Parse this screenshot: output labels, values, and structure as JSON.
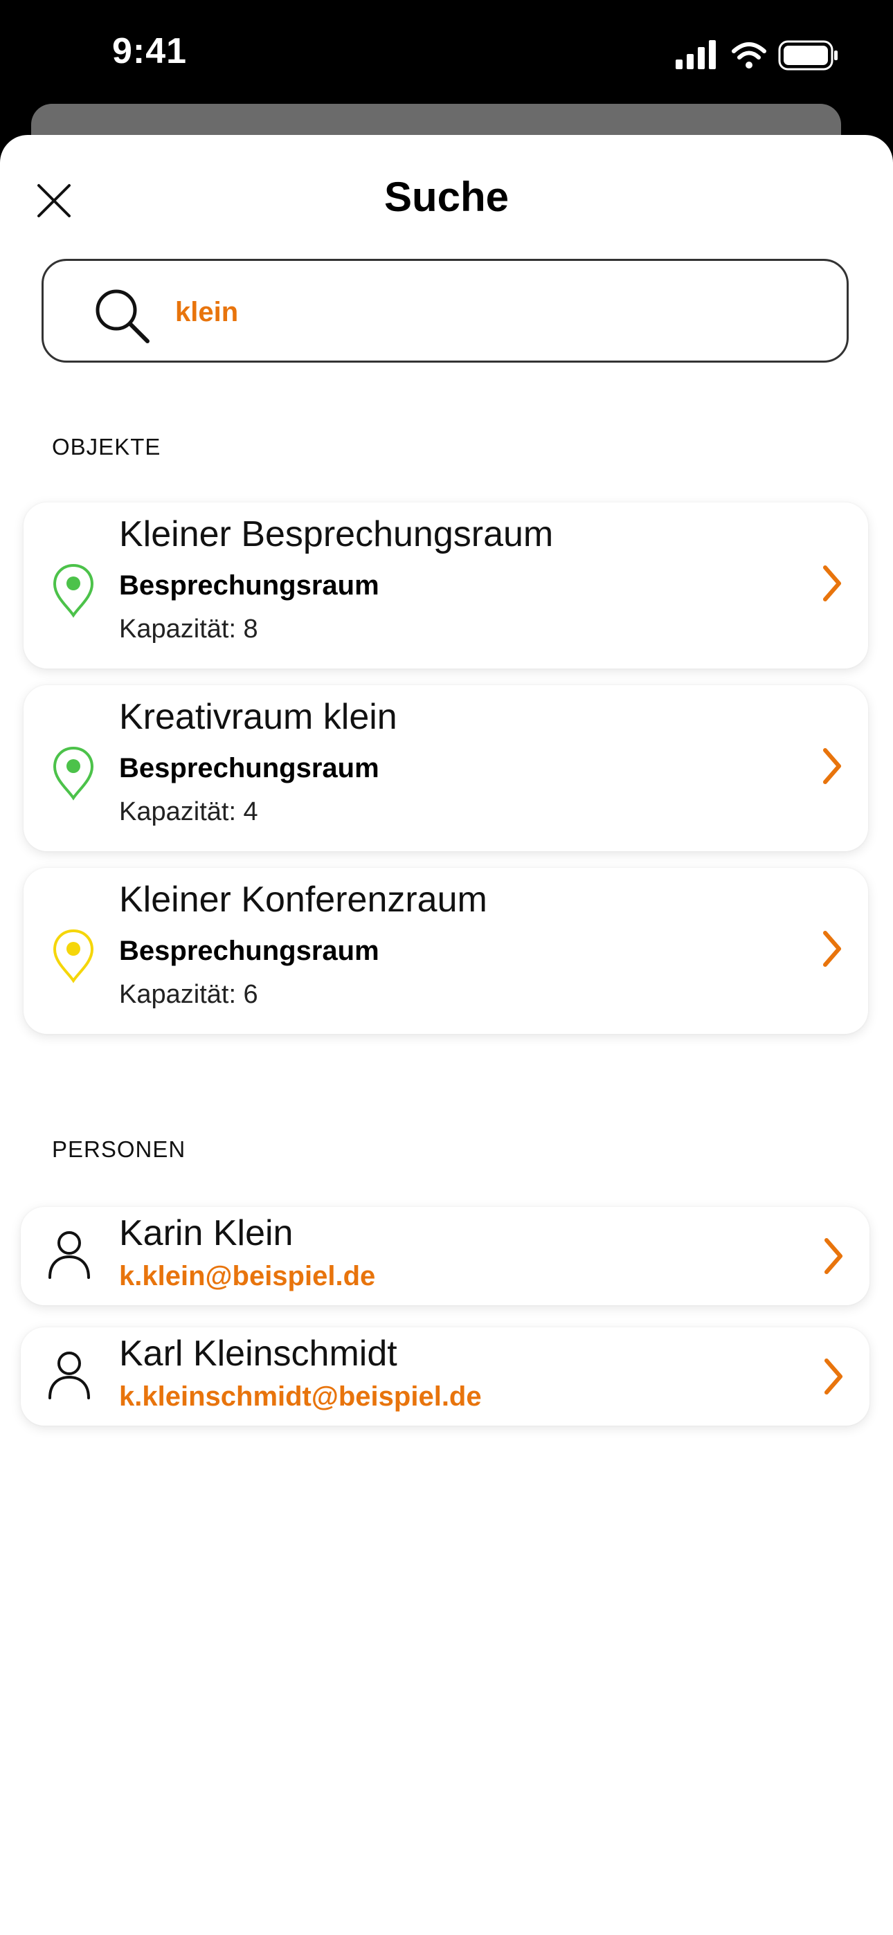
{
  "status_bar": {
    "time": "9:41"
  },
  "header": {
    "title": "Suche",
    "close_icon": "close-icon"
  },
  "search": {
    "value": "klein",
    "icon": "search-icon"
  },
  "sections": {
    "objects_label": "OBJEKTE",
    "persons_label": "PERSONEN"
  },
  "objects": [
    {
      "title": "Kleiner Besprechungsraum",
      "type": "Besprechungsraum",
      "capacity": "Kapazität: 8",
      "pin_color": "#4cc24a"
    },
    {
      "title": "Kreativraum klein",
      "type": "Besprechungsraum",
      "capacity": "Kapazität: 4",
      "pin_color": "#4cc24a"
    },
    {
      "title": "Kleiner Konferenzraum",
      "type": "Besprechungsraum",
      "capacity": "Kapazität: 6",
      "pin_color": "#f5d60a"
    }
  ],
  "persons": [
    {
      "name": "Karin Klein",
      "email": "k.klein@beispiel.de"
    },
    {
      "name": "Karl Kleinschmidt",
      "email": "k.kleinschmidt@beispiel.de"
    }
  ],
  "colors": {
    "accent": "#e8740c",
    "available": "#4cc24a",
    "partial": "#f5d60a"
  }
}
